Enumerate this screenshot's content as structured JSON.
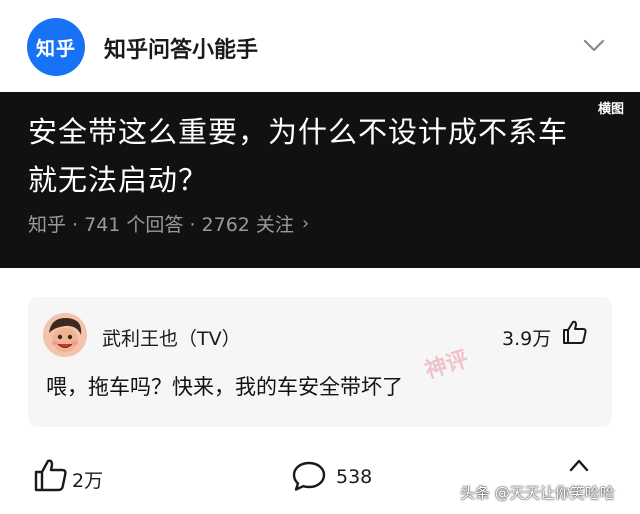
{
  "header": {
    "logo_text": "知乎",
    "account_name": "知乎问答小能手"
  },
  "question": {
    "landscape_label": "横图",
    "title": "安全带这么重要，为什么不设计成不系车就无法启动？",
    "meta": "知乎 · 741 个回答 · 2762 关注"
  },
  "answer": {
    "author": "武利王也（TV）",
    "likes": "3.9万",
    "text": "喂，拖车吗？快来，我的车安全带坏了",
    "stamp_text": "神评"
  },
  "actions": {
    "like_count": "2万",
    "comment_count": "538"
  },
  "watermark": "头条 @天天让你笑哈哈",
  "colors": {
    "brand": "#1772f6",
    "card_dark": "#111111",
    "answer_bg": "#f6f6f6"
  },
  "icons": [
    "chevron-down-icon",
    "chevron-right-icon",
    "thumbs-up-icon",
    "comment-icon",
    "share-icon"
  ]
}
